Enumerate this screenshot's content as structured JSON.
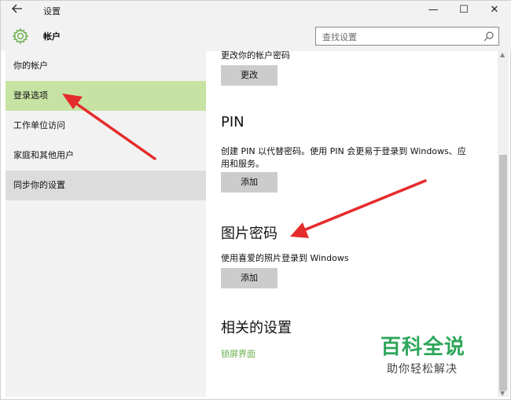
{
  "window": {
    "app_title": "设置",
    "back_icon": "back-arrow-icon",
    "minimize_symbol": "—",
    "maximize_symbol": "☐",
    "close_symbol": "✕"
  },
  "header": {
    "title": "帐户",
    "icon": "gear-icon",
    "accent_color": "#6ab04c",
    "search_placeholder": "查找设置"
  },
  "sidebar": {
    "items": [
      {
        "label": "你的帐户"
      },
      {
        "label": "登录选项"
      },
      {
        "label": "工作单位访问"
      },
      {
        "label": "家庭和其他用户"
      },
      {
        "label": "同步你的设置"
      }
    ],
    "selected_index": 1,
    "selected_color": "#c6e3a3"
  },
  "main": {
    "password_text": "更改你的帐户密码",
    "change_button": "更改",
    "pin_heading": "PIN",
    "pin_desc_line1": "创建 PIN 以代替密码。使用 PIN 会更易于登录到 Windows、应",
    "pin_desc_line2": "用和服务。",
    "pin_add_button": "添加",
    "picture_heading": "图片密码",
    "picture_desc": "使用喜爱的照片登录到 Windows",
    "picture_add_button": "添加",
    "related_heading": "相关的设置",
    "lockscreen_link": "锁屏界面",
    "link_color": "#6ab04c"
  },
  "watermark": {
    "main": "百科全说",
    "sub": "助你轻松解决",
    "color": "#2ea65a"
  },
  "annotations": {
    "arrow_color": "#e52b2b"
  }
}
